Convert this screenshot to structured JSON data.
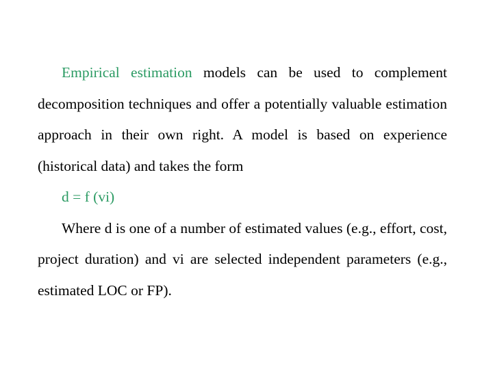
{
  "paragraph1": {
    "highlight": "Empirical estimation",
    "rest": " models can be used to complement decomposition techniques and offer a potentially valuable estimation approach in their own right. A model is based on experience (historical data) and takes the form"
  },
  "formula": "d = f (vi)",
  "paragraph2": "Where d is one of a number of estimated values (e.g., effort, cost, project duration) and vi are selected independent parameters (e.g., estimated LOC or FP).",
  "colors": {
    "highlight": "#2a9a62",
    "text": "#000000",
    "background": "#ffffff"
  }
}
